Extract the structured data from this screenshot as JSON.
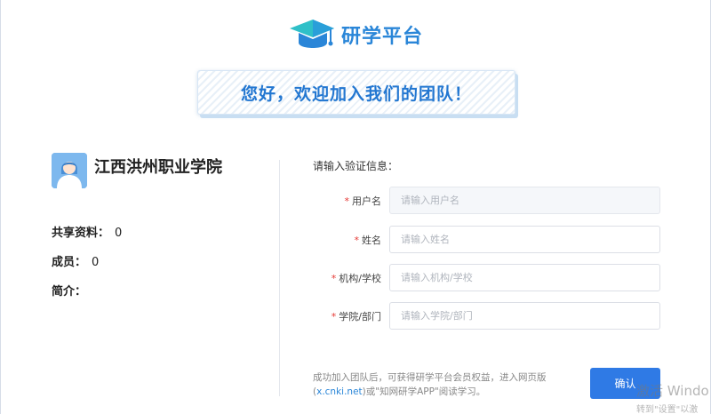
{
  "header": {
    "logo_text": "研学平台",
    "welcome_banner": "您好，欢迎加入我们的团队！"
  },
  "team": {
    "name": "江西洪州职业学院",
    "stats": [
      {
        "label": "共享资料：",
        "value": "0"
      },
      {
        "label": "成员：",
        "value": "0"
      },
      {
        "label": "简介：",
        "value": ""
      }
    ]
  },
  "form": {
    "title": "请输入验证信息：",
    "required_mark": "*",
    "fields": [
      {
        "label": "用户名",
        "placeholder": "请输入用户名",
        "value": ""
      },
      {
        "label": "姓名",
        "placeholder": "请输入姓名",
        "value": ""
      },
      {
        "label": "机构/学校",
        "placeholder": "请输入机构/学校",
        "value": ""
      },
      {
        "label": "学院/部门",
        "placeholder": "请输入学院/部门",
        "value": ""
      }
    ],
    "note_before_link": "成功加入团队后，可获得研学平台会员权益，进入网页版(",
    "note_link": "x.cnki.net",
    "note_after_link": ")或\"知网研学APP\"阅读学习。",
    "confirm_label": "确认"
  },
  "watermark": {
    "line1": "激活 Windo",
    "line2": "转到\"设置\"以激"
  },
  "colors": {
    "brand_blue": "#2a86d8",
    "button_blue": "#2f7ae5",
    "required_red": "#e53935"
  },
  "icons": {
    "logo": "graduation-cap-icon",
    "avatar": "user-avatar-icon"
  }
}
